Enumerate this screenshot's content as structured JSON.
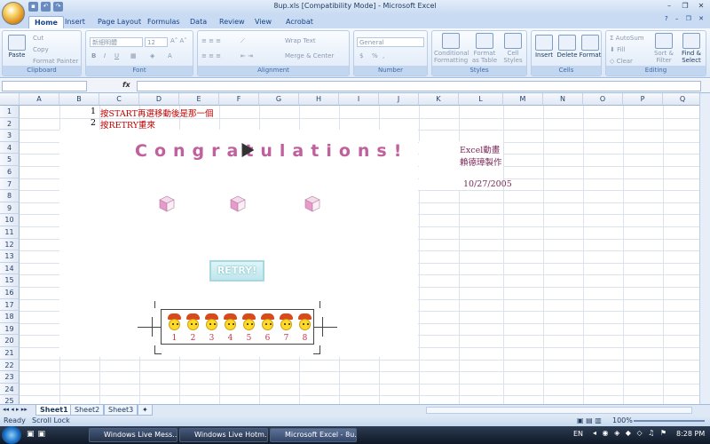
{
  "window": {
    "title": "8up.xls  [Compatibility Mode] - Microsoft Excel",
    "controls": [
      "–",
      "❐",
      "✕"
    ]
  },
  "tabs": [
    "Home",
    "Insert",
    "Page Layout",
    "Formulas",
    "Data",
    "Review",
    "View",
    "Acrobat"
  ],
  "ribbon": {
    "clipboard": {
      "label": "Clipboard",
      "paste": "Paste",
      "cut": "Cut",
      "copy": "Copy",
      "format_painter": "Format Painter"
    },
    "font": {
      "label": "Font",
      "name": "新細明體",
      "size": "12"
    },
    "alignment": {
      "label": "Alignment",
      "wrap": "Wrap Text",
      "merge": "Merge & Center"
    },
    "number": {
      "label": "Number",
      "format": "General",
      "currency": "$",
      "percent": "%",
      "comma": ","
    },
    "styles": {
      "label": "Styles",
      "conditional": "Conditional Formatting",
      "as_table": "Format as Table",
      "cell": "Cell Styles"
    },
    "cells": {
      "label": "Cells",
      "insert": "Insert",
      "delete": "Delete",
      "format": "Format"
    },
    "editing": {
      "label": "Editing",
      "autosum": "AutoSum",
      "fill": "Fill",
      "clear": "Clear",
      "sort": "Sort & Filter",
      "find": "Find & Select"
    }
  },
  "formula_bar": {
    "fx": "fx"
  },
  "columns": [
    "A",
    "B",
    "C",
    "D",
    "E",
    "F",
    "G",
    "H",
    "I",
    "J",
    "K",
    "L",
    "M",
    "N",
    "O",
    "P",
    "Q"
  ],
  "rows": [
    "1",
    "2",
    "3",
    "4",
    "5",
    "6",
    "7",
    "8",
    "9",
    "10",
    "11",
    "12",
    "13",
    "14",
    "15",
    "16",
    "17",
    "18",
    "19",
    "20",
    "21",
    "22",
    "23",
    "24",
    "25"
  ],
  "cells": {
    "b1": "1",
    "c1": "按START再選移動後是那一個",
    "b2": "2",
    "c2": "按RETRY重來",
    "l4": "Excel動畫",
    "l5": "賴德璋製作",
    "l7": "10/27/2005"
  },
  "congrats": "Congratulations!",
  "retry_label": "RETRY!",
  "chick_numbers": [
    "1",
    "2",
    "3",
    "4",
    "5",
    "6",
    "7",
    "8"
  ],
  "sheets": [
    "Sheet1",
    "Sheet2",
    "Sheet3"
  ],
  "status": {
    "ready": "Ready",
    "scroll_lock": "Scroll Lock",
    "zoom": "100%"
  },
  "taskbar": {
    "items": [
      "Windows Live Mess...",
      "Windows Live Hotm...",
      "Microsoft Excel - 8u..."
    ],
    "lang": "EN",
    "time": "8:28 PM"
  }
}
